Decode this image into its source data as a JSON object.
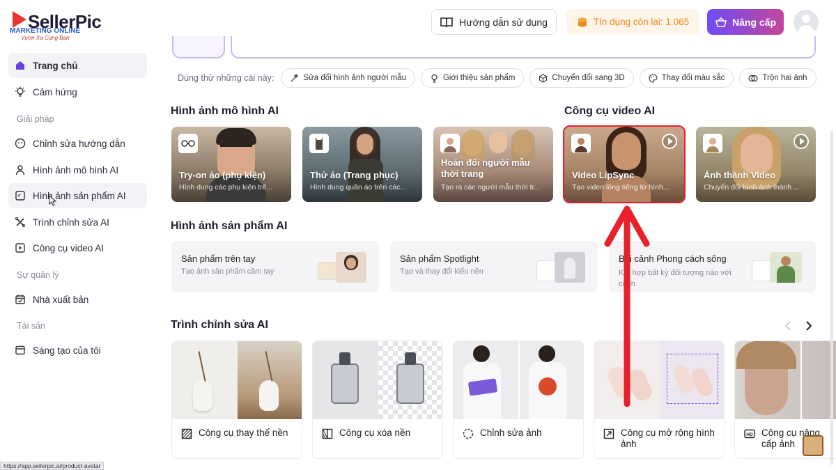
{
  "logo": {
    "brand": "SellerPic",
    "line1": "MARKETING ONLINE",
    "line2": "Vươn Xa Cùng Bạn"
  },
  "header": {
    "guide_label": "Hướng dẫn sử dụng",
    "credit_label": "Tín dụng còn lại: 1.065",
    "upgrade_label": "Nâng cấp"
  },
  "sidebar": {
    "items": [
      {
        "label": "Trang chủ",
        "icon": "home-icon"
      },
      {
        "label": "Cảm hứng",
        "icon": "lightbulb-icon"
      },
      {
        "label": "Chỉnh sửa hướng dẫn",
        "icon": "face-icon"
      },
      {
        "label": "Hình ảnh mô hình AI",
        "icon": "person-icon"
      },
      {
        "label": "Hình ảnh sản phẩm AI",
        "icon": "tag-icon"
      },
      {
        "label": "Trình chỉnh sửa AI",
        "icon": "tools-icon"
      },
      {
        "label": "Công cụ video AI",
        "icon": "video-icon"
      },
      {
        "label": "Nhà xuất bản",
        "icon": "calendar-icon"
      },
      {
        "label": "Sáng tạo của tôi",
        "icon": "folder-icon"
      }
    ],
    "sections": [
      "Giải pháp",
      "Sự quản lý",
      "Tài sản"
    ]
  },
  "try_row": {
    "label": "Dùng thử những cái này:",
    "chips": [
      {
        "label": "Sửa đổi hình ảnh người mẫu",
        "icon": "wand-icon"
      },
      {
        "label": "Giới thiệu sản phẩm",
        "icon": "bulb-icon"
      },
      {
        "label": "Chuyển đổi sang 3D",
        "icon": "cube-icon"
      },
      {
        "label": "Thay đổi màu sắc",
        "icon": "palette-icon"
      },
      {
        "label": "Trộn hai ảnh",
        "icon": "blend-icon"
      }
    ]
  },
  "model_section": {
    "title": "Hình ảnh mô hình AI",
    "cards": [
      {
        "title": "Try-on ảo (phụ kiện)",
        "subtitle": "Hình dung các phụ kiện trê..."
      },
      {
        "title": "Thử ảo (Trang phục)",
        "subtitle": "Hình dung quần áo trên các..."
      },
      {
        "title": "Hoán đổi người mẫu thời trang",
        "subtitle": "Tạo ra các người mẫu thời tr..."
      }
    ]
  },
  "video_section": {
    "title": "Công cụ video AI",
    "cards": [
      {
        "title": "Video LipSync",
        "subtitle": "Tạo video lồng tiếng từ hình..."
      },
      {
        "title": "Ảnh thành Video",
        "subtitle": "Chuyển đổi hình ảnh thành ..."
      }
    ]
  },
  "product_section": {
    "title": "Hình ảnh sản phẩm AI",
    "cards": [
      {
        "title": "Sản phẩm trên tay",
        "subtitle": "Tạo ảnh sản phẩm cầm tay"
      },
      {
        "title": "Sản phẩm Spotlight",
        "subtitle": "Tạo và thay đổi kiểu nền"
      },
      {
        "title": "Bối cảnh Phong cách sống",
        "subtitle": "Kết hợp bất kỳ đối tượng nào với",
        "subtitle2": "cảnh"
      }
    ]
  },
  "editor_section": {
    "title": "Trình chỉnh sửa AI",
    "cards": [
      {
        "label": "Công cụ thay thế nền",
        "icon": "hatch-icon"
      },
      {
        "label": "Công cụ xóa nền",
        "icon": "erase-icon"
      },
      {
        "label": "Chỉnh sửa ảnh",
        "icon": "edit-circle-icon"
      },
      {
        "label": "Công cụ mở rộng hình ảnh",
        "icon": "expand-icon"
      },
      {
        "label": "Công cụ nâng cấp ảnh",
        "icon": "hd-icon"
      }
    ]
  },
  "status_bar": {
    "url": "https://app.sellerpic.ai/product-avatar"
  },
  "colors": {
    "accent": "#7b4df6",
    "highlight": "#e0202e",
    "credit": "#e8891a"
  }
}
